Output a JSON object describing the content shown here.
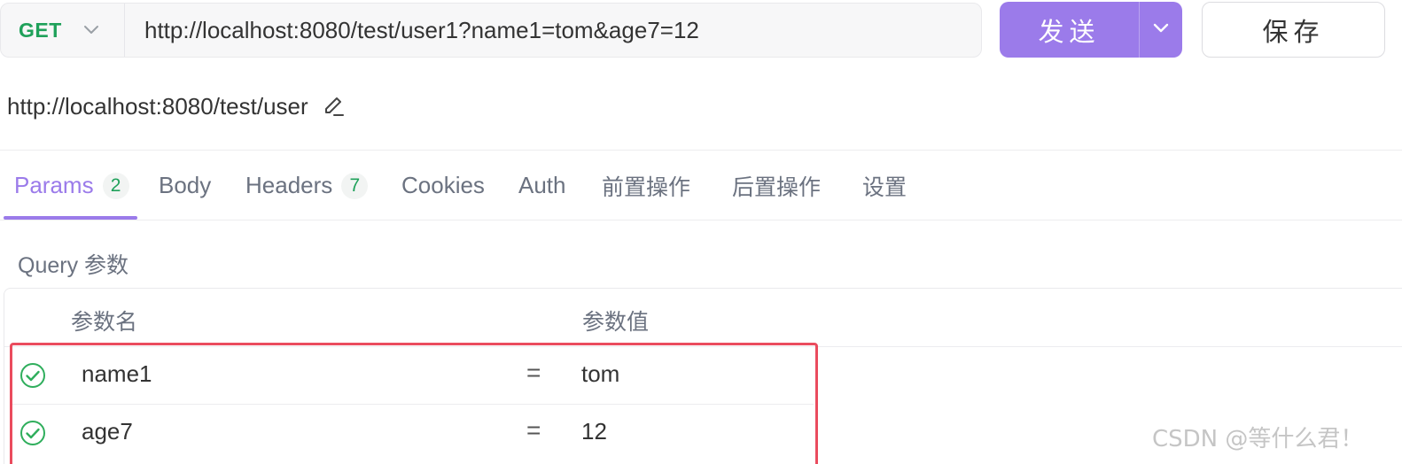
{
  "request": {
    "method": "GET",
    "url": "http://localhost:8080/test/user1?name1=tom&age7=12",
    "send_label": "发送",
    "save_label": "保存"
  },
  "api_name": "http://localhost:8080/test/user",
  "tabs": [
    {
      "label": "Params",
      "badge": "2",
      "active": true
    },
    {
      "label": "Body"
    },
    {
      "label": "Headers",
      "badge": "7"
    },
    {
      "label": "Cookies"
    },
    {
      "label": "Auth"
    },
    {
      "label": "前置操作"
    },
    {
      "label": "后置操作"
    },
    {
      "label": "设置"
    }
  ],
  "query": {
    "title": "Query 参数",
    "headers": {
      "name": "参数名",
      "value": "参数值"
    },
    "rows": [
      {
        "name": "name1",
        "eq": "=",
        "value": "tom",
        "enabled": true
      },
      {
        "name": "age7",
        "eq": "=",
        "value": "12",
        "enabled": true
      }
    ]
  },
  "colors": {
    "accent": "#9b7bea",
    "method_green": "#1fa15a",
    "highlight_red": "#ea4c5e"
  },
  "watermark": "CSDN @等什么君！"
}
